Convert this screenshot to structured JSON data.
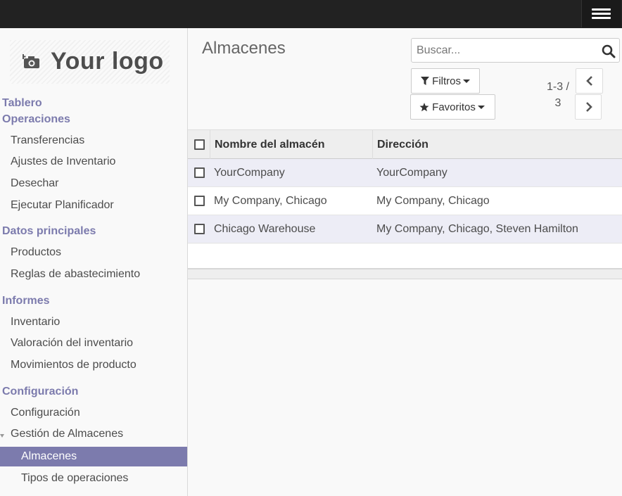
{
  "sidebar": {
    "logo_text": "Your logo",
    "sections": {
      "tablero": "Tablero",
      "operaciones": "Operaciones",
      "datos": "Datos principales",
      "informes": "Informes",
      "configuracion": "Configuración"
    },
    "items": {
      "transferencias": "Transferencias",
      "ajustes": "Ajustes de Inventario",
      "desechar": "Desechar",
      "planificador": "Ejecutar Planificador",
      "productos": "Productos",
      "reglas": "Reglas de abastecimiento",
      "inventario": "Inventario",
      "valoracion": "Valoración del inventario",
      "movimientos": "Movimientos de producto",
      "config": "Configuración",
      "gestion": "Gestión de Almacenes",
      "almacenes": "Almacenes",
      "tipos": "Tipos de operaciones"
    }
  },
  "main": {
    "title": "Almacenes",
    "search_placeholder": "Buscar...",
    "filters_label": "Filtros",
    "favorites_label": "Favoritos",
    "pager_range": "1-3 /",
    "pager_total": "3"
  },
  "table": {
    "headers": {
      "name": "Nombre del almacén",
      "address": "Dirección"
    },
    "rows": [
      {
        "name": "YourCompany",
        "address": "YourCompany"
      },
      {
        "name": "My Company, Chicago",
        "address": "My Company, Chicago"
      },
      {
        "name": "Chicago Warehouse",
        "address": "My Company, Chicago, Steven Hamilton"
      }
    ]
  },
  "colors": {
    "accent": "#7c7bad",
    "topbar": "#222222",
    "row_highlight": "#ededf6"
  }
}
